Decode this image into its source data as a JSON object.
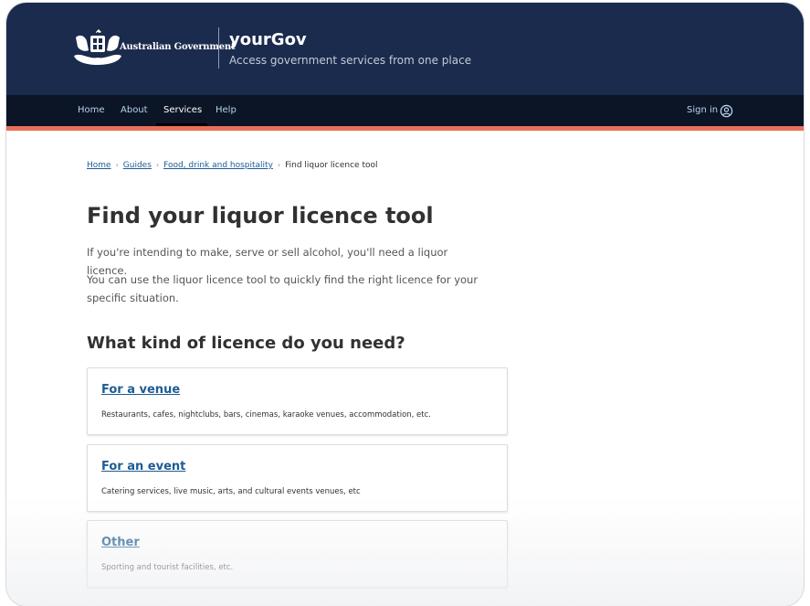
{
  "header": {
    "logo_text": "Australian Government",
    "site_name": "yourGov",
    "tagline": "Access government services from one place"
  },
  "nav": {
    "items": [
      {
        "label": "Home"
      },
      {
        "label": "About"
      },
      {
        "label": "Services",
        "active": true
      },
      {
        "label": "Help"
      }
    ],
    "sign_in": "Sign in"
  },
  "breadcrumb": [
    "Home",
    "Guides",
    "Food, drink and hospitality",
    "Find liquor licence tool"
  ],
  "page": {
    "title": "Find your liquor licence tool",
    "intro": [
      "If you're intending to make, serve or sell alcohol, you'll need a liquor licence.",
      "You can use the liquor licence tool to quickly find the right licence for your specific situation."
    ],
    "subheading": "What kind of licence do you need?"
  },
  "cards": [
    {
      "title": "For a venue",
      "description": "Restaurants, cafes, nightclubs, bars, cinemas, karaoke venues, accommodation, etc."
    },
    {
      "title": "For an event",
      "description": "Catering services, live music, arts, and cultural events venues, etc"
    },
    {
      "title": "Other",
      "description": "Sporting and tourist facilities, etc."
    }
  ],
  "colors": {
    "header_bg": "#1b2b4d",
    "nav_bg": "#0b1526",
    "accent": "#e8715a",
    "link": "#1d5c94"
  }
}
